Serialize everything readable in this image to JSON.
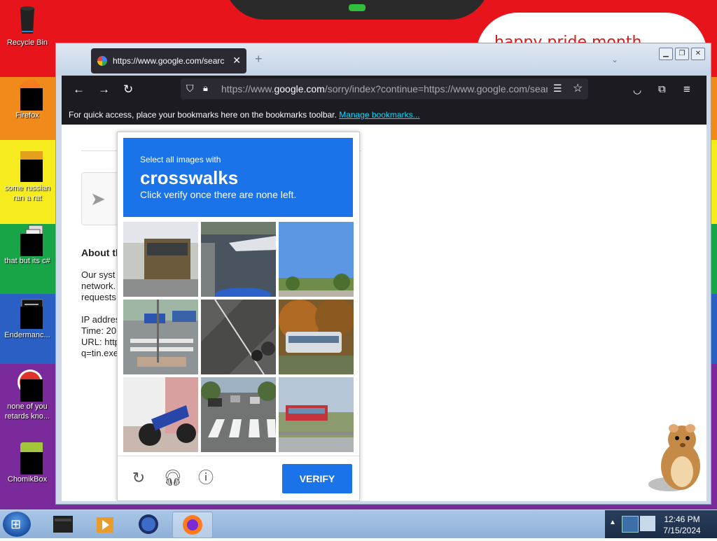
{
  "desktop": {
    "banner_text": "happy pride month",
    "icons": [
      {
        "label": "Recycle Bin"
      },
      {
        "label": "Firefox"
      },
      {
        "label": "some russian ran a rat"
      },
      {
        "label": "that but its c#"
      },
      {
        "label": "Endermanc..."
      },
      {
        "label": "none of you retards kno..."
      },
      {
        "label": "ChomikBox"
      }
    ]
  },
  "browser": {
    "tab_title": "https://www.google.com/search",
    "new_tab": "+",
    "url_prefix": "https://www.",
    "url_host": "google.com",
    "url_rest": "/sorry/index?continue=https://www.google.com/search",
    "bookmarks_text": "For quick access, place your bookmarks here on the bookmarks toolbar.",
    "bookmarks_link": "Manage bookmarks..."
  },
  "page": {
    "about_heading": "About th",
    "lines": [
      "Our syst",
      "network.",
      "requests",
      "",
      "IP addres",
      "Time: 20",
      "URL: http",
      "q=tin.exe"
    ]
  },
  "captcha": {
    "instruction": "Select all images with",
    "target": "crosswalks",
    "subtext": "Click verify once there are none left.",
    "verify_label": "VERIFY"
  },
  "taskbar": {
    "time": "12:46 PM",
    "date": "7/15/2024"
  },
  "colors": {
    "captcha_blue": "#1a73e8",
    "firefox_dark": "#1c1b22"
  }
}
